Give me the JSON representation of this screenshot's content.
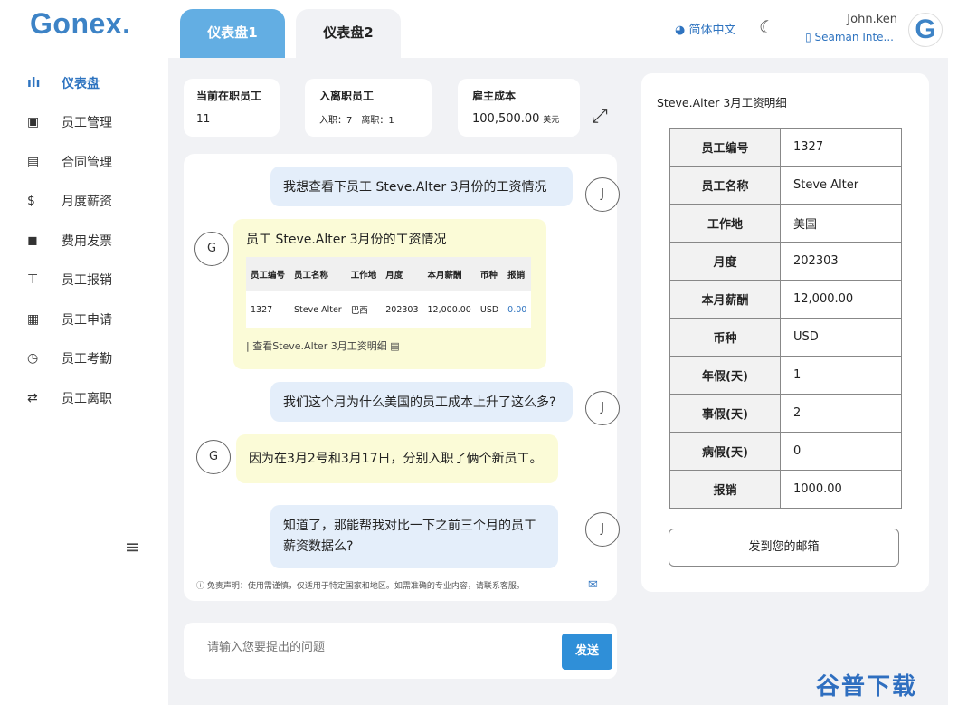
{
  "brand": "Gonex.",
  "sidebar": {
    "items": [
      {
        "icon": "bar-chart-icon",
        "glyph": "ılı",
        "label": "仪表盘"
      },
      {
        "icon": "contact-card-icon",
        "glyph": "▣",
        "label": "员工管理"
      },
      {
        "icon": "document-icon",
        "glyph": "▤",
        "label": "合同管理"
      },
      {
        "icon": "dollar-icon",
        "glyph": "$",
        "label": "月度薪资"
      },
      {
        "icon": "briefcase-icon",
        "glyph": "◼",
        "label": "费用发票"
      },
      {
        "icon": "pin-icon",
        "glyph": "⊤",
        "label": "员工报销"
      },
      {
        "icon": "id-card-icon",
        "glyph": "▦",
        "label": "员工申请"
      },
      {
        "icon": "clock-icon",
        "glyph": "◷",
        "label": "员工考勤"
      },
      {
        "icon": "swap-icon",
        "glyph": "⇄",
        "label": "员工离职"
      }
    ],
    "menu_glyph": "≡"
  },
  "tabs": [
    "仪表盘1",
    "仪表盘2"
  ],
  "header": {
    "lang": "简体中文",
    "user": "John.ken",
    "org": "Seaman Inte...",
    "avatar": "G",
    "moon_glyph": "☾",
    "lang_glyph": "◕",
    "org_glyph": "▯"
  },
  "stats": [
    {
      "title": "当前在职员工",
      "value": "11"
    },
    {
      "title": "入离职员工",
      "in": "入职：7",
      "out": "离职：1"
    },
    {
      "title": "雇主成本",
      "value": "100,500.00",
      "unit": "美元"
    }
  ],
  "expand_glyph": "⤢",
  "chat": {
    "u1": "我想查看下员工 Steve.Alter 3月份的工资情况",
    "a1_title": "员工 Steve.Alter 3月份的工资情况",
    "mini_headers": [
      "员工编号",
      "员工名称",
      "工作地",
      "月度",
      "本月薪酬",
      "币种",
      "报销"
    ],
    "mini_row": [
      "1327",
      "Steve Alter",
      "巴西",
      "202303",
      "12,000.00",
      "USD",
      "0.00"
    ],
    "a1_link": "| 查看Steve.Alter 3月工资明细",
    "u2": "我们这个月为什么美国的员工成本上升了这么多?",
    "a2": "因为在3月2号和3月17日，分别入职了俩个新员工。",
    "u3": "知道了，那能帮我对比一下之前三个月的员工薪资数据么?",
    "user_initial": "J",
    "bot_initial": "G",
    "disclaimer": "ⓘ 免责声明：使用需谨慎，仅适用于特定国家和地区。如需准确的专业内容，请联系客服。",
    "mail_glyph": "✉",
    "doc_glyph": "▤"
  },
  "input": {
    "placeholder": "请输入您要提出的问题",
    "send": "发送"
  },
  "detail": {
    "title": "Steve.Alter 3月工资明细",
    "rows": [
      [
        "员工编号",
        "1327"
      ],
      [
        "员工名称",
        "Steve Alter"
      ],
      [
        "工作地",
        "美国"
      ],
      [
        "月度",
        "202303"
      ],
      [
        "本月薪酬",
        "12,000.00"
      ],
      [
        "币种",
        "USD"
      ],
      [
        "年假(天)",
        "1"
      ],
      [
        "事假(天)",
        "2"
      ],
      [
        "病假(天)",
        "0"
      ],
      [
        "报销",
        "1000.00"
      ]
    ],
    "mail_btn": "发到您的邮箱"
  },
  "watermark": "谷普下载"
}
